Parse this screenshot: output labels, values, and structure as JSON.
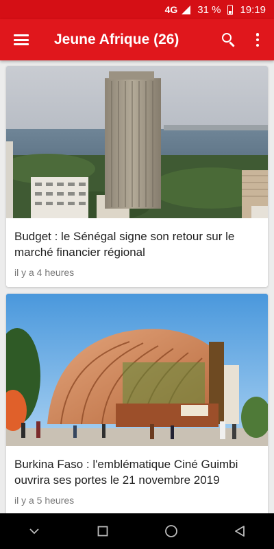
{
  "status": {
    "network": "4G",
    "battery": "31 %",
    "time": "19:19"
  },
  "app_bar": {
    "title": "Jeune Afrique (26)",
    "icons": [
      "menu-icon",
      "search-icon",
      "more-vert-icon"
    ]
  },
  "articles": [
    {
      "headline": "Budget : le Sénégal signe son retour sur le marché financier régional",
      "time": "il y a 4 heures",
      "image": "dakar-skyline-tower-photo"
    },
    {
      "headline": "Burkina Faso : l'emblématique Ciné Guimbi ouvrira ses portes le 21 novembre 2019",
      "time": "il y a 5 heures",
      "image": "cine-guimbi-building-render"
    }
  ],
  "nav": {
    "icons": [
      "chevron-down-icon",
      "recents-square-icon",
      "home-circle-icon",
      "back-triangle-icon"
    ]
  },
  "colors": {
    "status_bar": "#d50f15",
    "app_bar": "#e0171c",
    "background": "#ececec"
  }
}
